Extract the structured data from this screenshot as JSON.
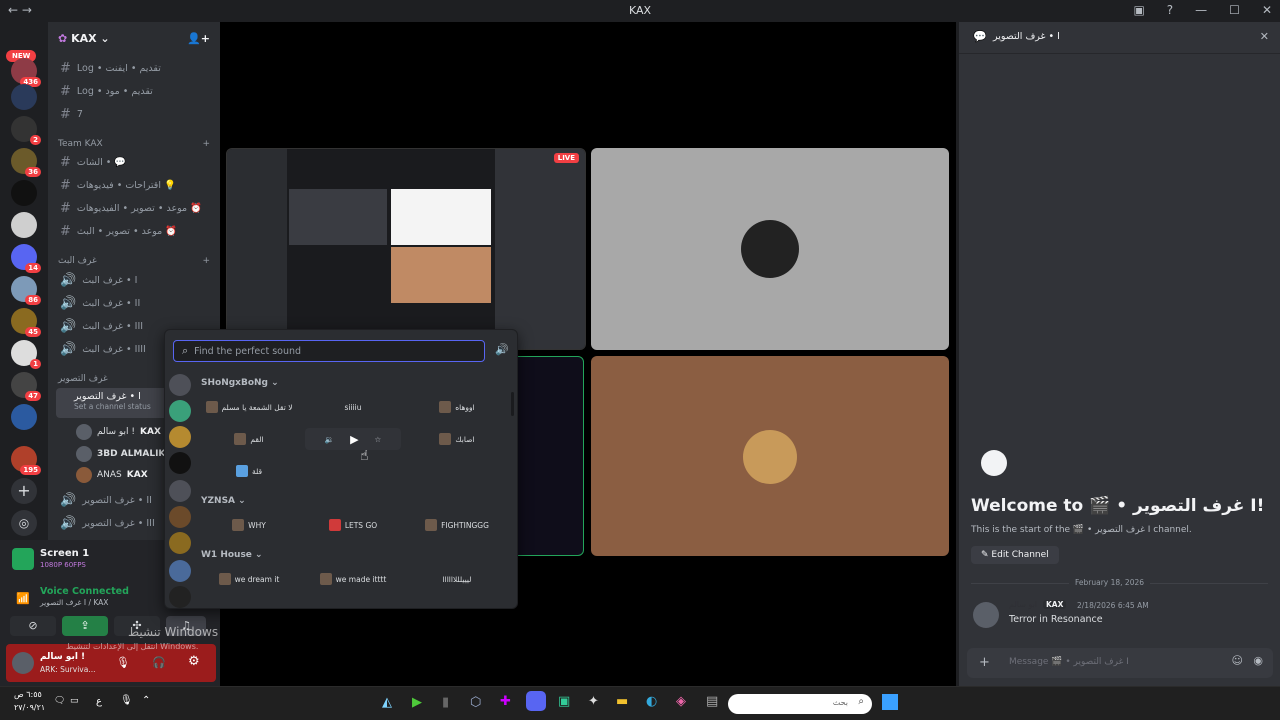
{
  "window": {
    "title": "KAX"
  },
  "servers": {
    "new_label": "NEW",
    "badges": [
      "436",
      "2",
      "36",
      "14",
      "86",
      "45",
      "1",
      "47",
      "195"
    ]
  },
  "sidebar": {
    "server_name": "KAX",
    "top_channels": [
      "Log • تقديم • ايفنت",
      "Log • تقديم • مود",
      "7"
    ],
    "category_team": "Team KAX",
    "team_channels": [
      "الشات • 💬",
      "اقتراحات • فيديوهات 💡",
      "موعد • تصوير • الفيديوهات ⏰",
      "موعد • تصوير • البث ⏰"
    ],
    "category_stream": "غرف البث",
    "stream_channels": [
      "غرف البث • I",
      "غرف البث • II",
      "غرف البث • III",
      "غرف البث • IIII"
    ],
    "category_photo": "غرف التصوير",
    "active_channel": "غرف التصوير • I",
    "channel_status": "Set a channel status",
    "voice_users": [
      {
        "name": "ابو سالم !",
        "tag": "KAX"
      },
      {
        "name": "3BD ALMALIK",
        "tag": ""
      },
      {
        "name": "ANAS",
        "tag": "KAX"
      }
    ],
    "more_channels": [
      "غرف التصوير • II",
      "غرف التصوير • III"
    ]
  },
  "screen": {
    "title": "Screen 1",
    "quality": "1080P 60FPS"
  },
  "voice": {
    "status": "Voice Connected",
    "location": "غرف التصوير I / KAX"
  },
  "activation": {
    "title": "تنشيط Windows",
    "subtitle": "انتقل إلى الإعدادات لتنشيط Windows."
  },
  "user": {
    "name": "ابو سالم !",
    "activity": "ARK: Surviva..."
  },
  "stage": {
    "live_badge": "LIVE"
  },
  "soundboard": {
    "search_placeholder": "Find the perfect sound",
    "groups": [
      {
        "name": "SHoNgxBoNg",
        "sounds": [
          "لا تقل الشمعة يا مسلم",
          "siiiiu",
          "اووهاه",
          "القم",
          "",
          "اصابك",
          "قلة"
        ]
      },
      {
        "name": "YZNSA",
        "sounds": [
          "WHY",
          "LETS GO",
          "FIGHTINGGG"
        ]
      },
      {
        "name": "W1 House",
        "sounds": [
          "we dream it",
          "we made itttt",
          "ليييلللاااااا"
        ]
      }
    ]
  },
  "panel": {
    "header": "غرف التصوير • I",
    "welcome": "Welcome to 🎬 • غرف التصوير I!",
    "start_text": "This is the start of the 🎬 • غرف التصوير I channel.",
    "edit_button": "Edit Channel",
    "date_divider": "February 18, 2026",
    "message": {
      "author": "ابو سالم",
      "tag": "KAX",
      "time": "2/18/2026 6:45 AM",
      "text": "Terror in Resonance"
    },
    "input_placeholder": "Message 🎬 • غرف التصوير I"
  },
  "taskbar": {
    "search_placeholder": "بحث",
    "time": "٦:٥٥ ص",
    "date": "٢٧/٠٩/٢١",
    "lang": "ع"
  }
}
